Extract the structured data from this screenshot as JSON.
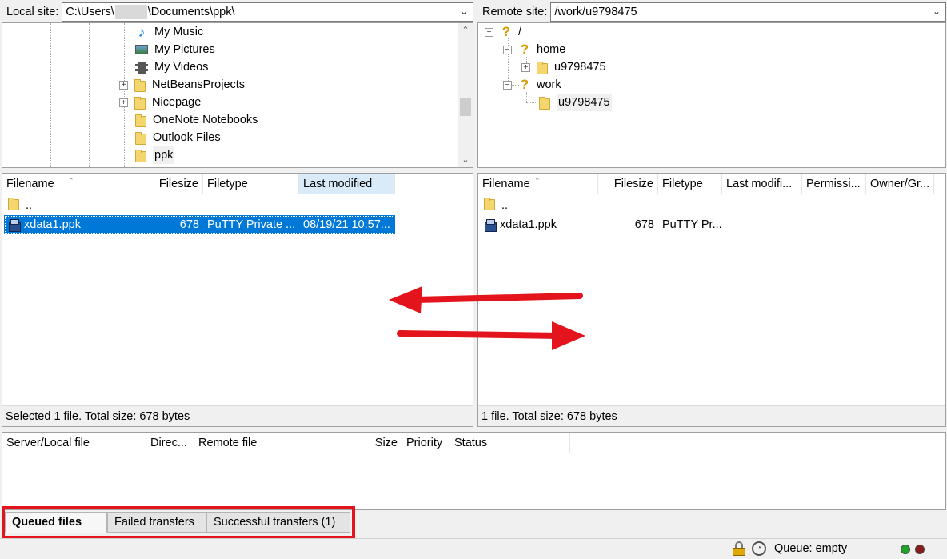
{
  "local": {
    "site_label": "Local site:",
    "path_prefix": "C:\\Users\\",
    "path_suffix": "\\Documents\\ppk\\",
    "tree": [
      {
        "label": "My Music",
        "icon": "music-icon",
        "expander": false
      },
      {
        "label": "My Pictures",
        "icon": "pictures-icon",
        "expander": false
      },
      {
        "label": "My Videos",
        "icon": "videos-icon",
        "expander": false
      },
      {
        "label": "NetBeansProjects",
        "icon": "folder-icon",
        "expander": true
      },
      {
        "label": "Nicepage",
        "icon": "folder-icon",
        "expander": true
      },
      {
        "label": "OneNote Notebooks",
        "icon": "folder-icon",
        "expander": false
      },
      {
        "label": "Outlook Files",
        "icon": "folder-icon",
        "expander": false
      },
      {
        "label": "ppk",
        "icon": "folder-icon",
        "expander": false
      }
    ],
    "columns": [
      "Filename",
      "Filesize",
      "Filetype",
      "Last modified"
    ],
    "rows": [
      {
        "name": "..",
        "size": "",
        "type": "",
        "modified": ""
      },
      {
        "name": "xdata1.ppk",
        "size": "678",
        "type": "PuTTY Private ...",
        "modified": "08/19/21 10:57..."
      }
    ],
    "status": "Selected 1 file. Total size: 678 bytes"
  },
  "remote": {
    "site_label": "Remote site:",
    "path": "/work/u9798475",
    "tree": [
      {
        "label": "/",
        "icon": "unknown-icon"
      },
      {
        "label": "home",
        "icon": "unknown-icon"
      },
      {
        "label": "u9798475",
        "icon": "folder-icon"
      },
      {
        "label": "work",
        "icon": "unknown-icon"
      },
      {
        "label": "u9798475",
        "icon": "folder-icon"
      }
    ],
    "columns": [
      "Filename",
      "Filesize",
      "Filetype",
      "Last modifi...",
      "Permissi...",
      "Owner/Gr..."
    ],
    "rows": [
      {
        "name": "..",
        "size": "",
        "type": ""
      },
      {
        "name": "xdata1.ppk",
        "size": "678",
        "type": "PuTTY Pr..."
      }
    ],
    "status": "1 file. Total size: 678 bytes"
  },
  "queue": {
    "columns": [
      "Server/Local file",
      "Direc...",
      "Remote file",
      "Size",
      "Priority",
      "Status"
    ],
    "tabs": [
      "Queued files",
      "Failed transfers",
      "Successful transfers (1)"
    ],
    "status_text": "Queue: empty"
  },
  "colors": {
    "selection": "#0078d7",
    "annotation_red": "#e3141b",
    "led_green": "#1fa32b",
    "led_red": "#8b1a1a"
  }
}
